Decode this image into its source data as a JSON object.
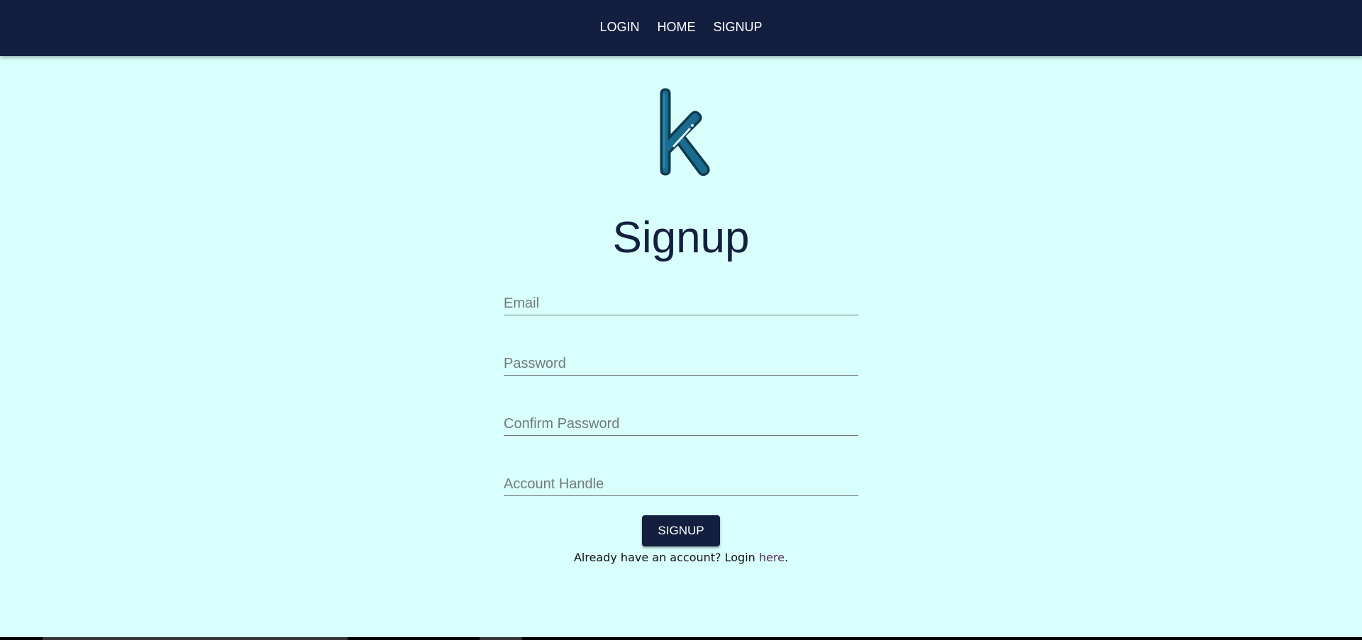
{
  "nav": {
    "items": [
      {
        "label": "LOGIN"
      },
      {
        "label": "HOME"
      },
      {
        "label": "SIGNUP"
      }
    ]
  },
  "logo": {
    "icon": "k-letter-logo-icon",
    "fill": "#1a6b8e",
    "outline": "#0d3a4c"
  },
  "page": {
    "title": "Signup"
  },
  "form": {
    "email_placeholder": "Email",
    "password_placeholder": "Password",
    "confirm_password_placeholder": "Confirm Password",
    "handle_placeholder": "Account Handle",
    "submit_label": "SIGNUP"
  },
  "footer": {
    "prefix": "Already have an account? Login ",
    "link": "here",
    "suffix": "."
  },
  "colors": {
    "navbar": "#131f3e",
    "background": "#d8fffc",
    "accent": "#131f3e",
    "link": "#5a2e5e"
  }
}
